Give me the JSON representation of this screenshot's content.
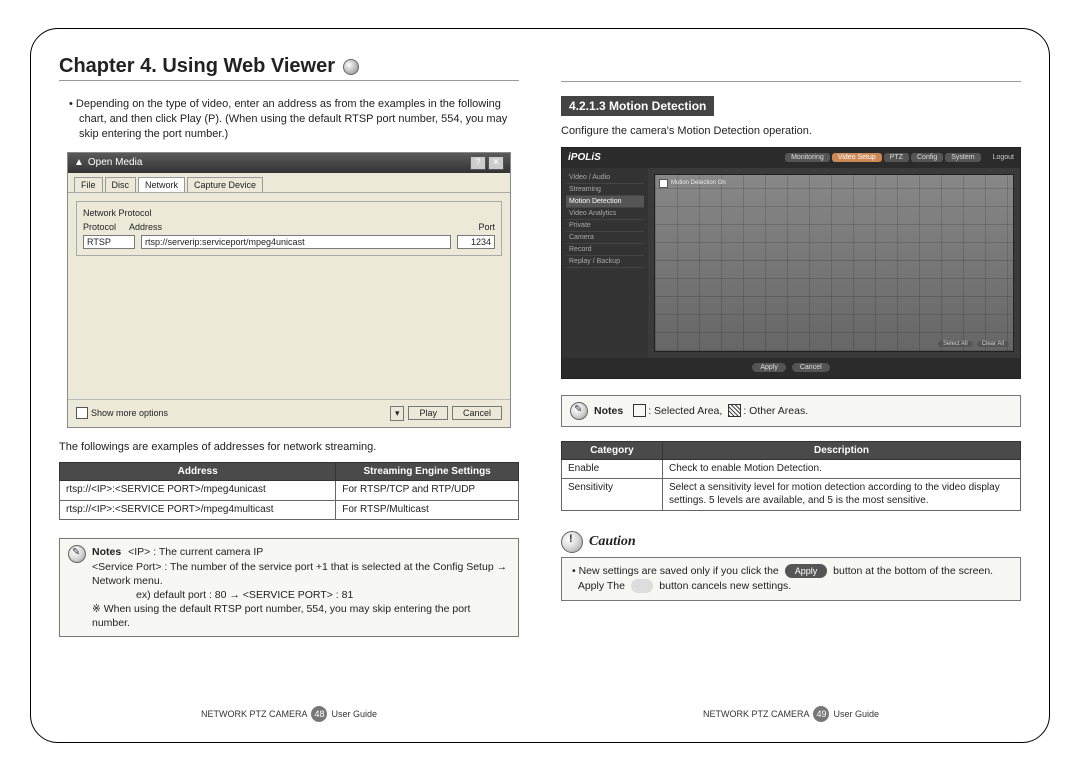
{
  "chapter_title": "Chapter 4. Using Web Viewer",
  "left": {
    "intro": "Depending on the type of video, enter an address as from the examples in the following chart, and then click Play (P). (When using the default RTSP port number, 554, you may skip entering the port number.)",
    "dialog": {
      "title": "Open Media",
      "tabs": [
        "File",
        "Disc",
        "Network",
        "Capture Device"
      ],
      "active_tab": "Network",
      "fieldset": "Network Protocol",
      "protocol_label": "Protocol",
      "address_label": "Address",
      "port_label": "Port",
      "protocol_value": "RTSP",
      "address_value": "rtsp://serverip:serviceport/mpeg4unicast",
      "port_value": "1234",
      "show_more": "Show more options",
      "play": "Play",
      "cancel": "Cancel"
    },
    "examples_intro": "The followings are examples of addresses for network streaming.",
    "table": {
      "headers": [
        "Address",
        "Streaming Engine Settings"
      ],
      "rows": [
        [
          "rtsp://<IP>:<SERVICE PORT>/mpeg4unicast",
          "For RTSP/TCP and RTP/UDP"
        ],
        [
          "rtsp://<IP>:<SERVICE PORT>/mpeg4multicast",
          "For RTSP/Multicast"
        ]
      ]
    },
    "notes_label": "Notes",
    "notes_lines": [
      "<IP> : The current camera IP",
      "<Service Port> : The number of the service port +1 that is selected at the Config Setup → Network menu.",
      "ex) default port : 80 → <SERVICE PORT> : 81",
      "※ When using the default RTSP port number, 554, you may skip entering the port number."
    ],
    "footer_product": "NETWORK PTZ CAMERA",
    "footer_page": "48",
    "footer_guide": "User Guide"
  },
  "right": {
    "section_heading": "4.2.1.3 Motion Detection",
    "section_intro": "Configure the camera's Motion Detection operation.",
    "ipolis": {
      "logo": "iPOLiS",
      "tabs": [
        "Monitoring",
        "Video Setup",
        "PTZ",
        "Config",
        "System"
      ],
      "tab_active": "Video Setup",
      "logout": "Logout",
      "side": [
        "Video / Audio",
        "Streaming",
        "Motion Detection",
        "Video Analytics",
        "Private",
        "Camera",
        "Record",
        "Replay / Backup"
      ],
      "side_active": "Motion Detection",
      "check_label": "Motion Detection On",
      "btn_select": "Select All",
      "btn_clear": "Clear All",
      "btn_apply": "Apply",
      "btn_cancel": "Cancel"
    },
    "notes_label": "Notes",
    "notes_legend_selected": ": Selected Area,",
    "notes_legend_other": ": Other Areas.",
    "table": {
      "headers": [
        "Category",
        "Description"
      ],
      "rows": [
        [
          "Enable",
          "Check to enable Motion Detection."
        ],
        [
          "Sensitivity",
          "Select a sensitivity level for motion detection according to the video display settings. 5 levels are available, and 5 is the most sensitive."
        ]
      ]
    },
    "caution_label": "Caution",
    "caution_line1_a": "New settings are saved only if you click the",
    "caution_apply": "Apply",
    "caution_line1_b": "button at the bottom of the screen.",
    "caution_line2_a": "Apply The",
    "caution_line2_b": "button cancels new settings.",
    "footer_product": "NETWORK PTZ CAMERA",
    "footer_page": "49",
    "footer_guide": "User Guide"
  }
}
